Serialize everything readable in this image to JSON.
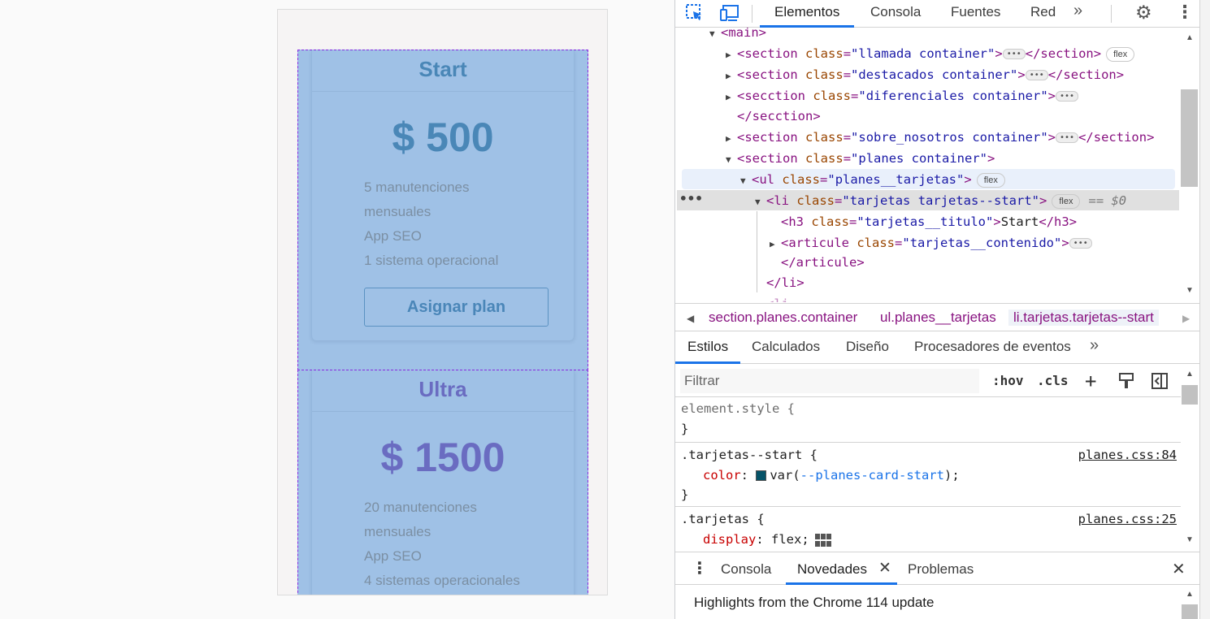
{
  "preview": {
    "cards": [
      {
        "title": "Start",
        "price": "$ 500",
        "features": [
          "5 manutenciones",
          "mensuales",
          "App SEO",
          "1 sistema operacional"
        ],
        "button": "Asignar plan"
      },
      {
        "title": "Ultra",
        "price": "$ 1500",
        "features": [
          "20 manutenciones",
          "mensuales",
          "App SEO",
          "4 sistemas operacionales"
        ]
      }
    ]
  },
  "devtools": {
    "tabs": [
      "Elementos",
      "Consola",
      "Fuentes",
      "Red"
    ],
    "more_tabs": "»",
    "dom": {
      "main": "<main>",
      "l1_tag": "section",
      "l1_attr": "class",
      "l1_val": "\"llamada container\"",
      "l1_close": "</section>",
      "l1_pill": "flex",
      "l2_tag": "section",
      "l2_attr": "class",
      "l2_val": "\"destacados container\"",
      "l2_close": "</section>",
      "l3_tag": "secction",
      "l3_attr": "class",
      "l3_val": "\"diferenciales container\"",
      "l3b_close": "</secction>",
      "l4_tag": "section",
      "l4_attr": "class",
      "l4_val": "\"sobre_nosotros container\"",
      "l4_close": "</section>",
      "l5_tag": "section",
      "l5_attr": "class",
      "l5_val": "\"planes container\"",
      "l6_tag": "ul",
      "l6_attr": "class",
      "l6_val": "\"planes__tarjetas\"",
      "l6_pill": "flex",
      "l7_tag": "li",
      "l7_attr": "class",
      "l7_val": "\"tarjetas tarjetas--start\"",
      "l7_pill": "flex",
      "l7_eq": "== $0",
      "l8_tag": "h3",
      "l8_attr": "class",
      "l8_val": "\"tarjetas__titulo\"",
      "l8_text": "Start",
      "l8_close": "</h3>",
      "l9_tag": "articule",
      "l9_attr": "class",
      "l9_val": "\"tarjetas__contenido\"",
      "l10_close": "</articule>",
      "l11_close": "</li>"
    },
    "breadcrumb": [
      "section.planes.container",
      "ul.planes__tarjetas",
      "li.tarjetas.tarjetas--start"
    ],
    "subtabs": [
      "Estilos",
      "Calculados",
      "Diseño",
      "Procesadores de eventos"
    ],
    "filter": {
      "placeholder": "Filtrar",
      "hov": ":hov",
      "cls": ".cls"
    },
    "styles": {
      "r1_sel": "element.style {",
      "r1_close": "}",
      "r2_sel": ".tarjetas--start {",
      "r2_src": "planes.css:84",
      "r2_prop": "color",
      "r2_func": "var(",
      "r2_var": "--planes-card-start",
      "r2_end": ");",
      "r2_close": "}",
      "r3_sel": ".tarjetas {",
      "r3_src": "planes.css:25",
      "r3_prop": "display",
      "r3_val": "flex;"
    },
    "drawer": {
      "tabs": [
        "Consola",
        "Novedades",
        "Problemas"
      ],
      "active": "Novedades",
      "content": "Highlights from the Chrome 114 update"
    }
  },
  "colors": {
    "accent": "#1a73e8",
    "card_bg": "#9fc1e6",
    "start_color": "#4a87b7",
    "ultra_color": "#6a6cc1",
    "swatch": "#065368"
  }
}
